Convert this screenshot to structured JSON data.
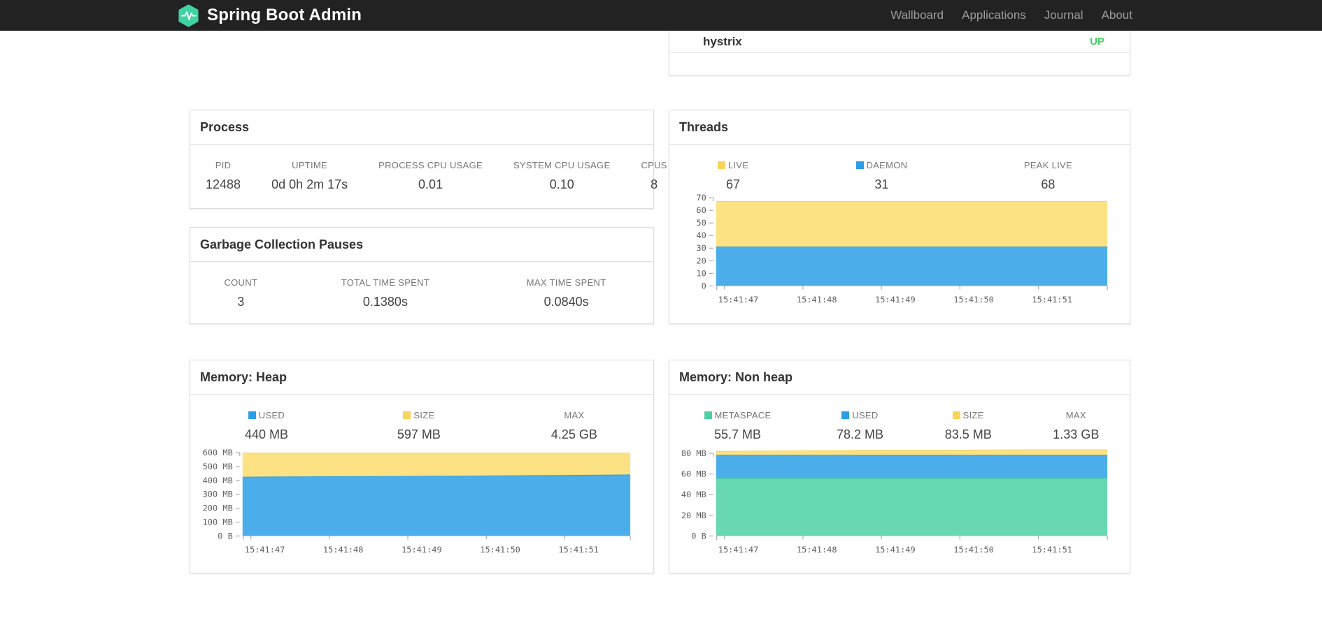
{
  "navbar": {
    "brand": "Spring Boot Admin",
    "items": [
      {
        "id": "wallboard",
        "label": "Wallboard"
      },
      {
        "id": "applications",
        "label": "Applications"
      },
      {
        "id": "journal",
        "label": "Journal"
      },
      {
        "id": "about",
        "label": "About"
      }
    ]
  },
  "colors": {
    "navbar_bg": "#222222",
    "brand_green": "#40d2a3",
    "status_up": "#44d35f",
    "area_yellow": "#fde283",
    "area_blue": "#4baeea",
    "area_green": "#67d8b1",
    "swatch_yellow": "#f8d45c",
    "swatch_blue": "#2b9ee5",
    "swatch_green": "#50cfa5"
  },
  "service_card": {
    "name": "hystrix",
    "status": "UP"
  },
  "cards": {
    "process": {
      "title": "Process",
      "stats": [
        {
          "label": "PID",
          "value": "12488"
        },
        {
          "label": "UPTIME",
          "value": "0d 0h 2m 17s"
        },
        {
          "label": "PROCESS CPU USAGE",
          "value": "0.01"
        },
        {
          "label": "SYSTEM CPU USAGE",
          "value": "0.10"
        },
        {
          "label": "CPUS",
          "value": "8"
        }
      ]
    },
    "gc": {
      "title": "Garbage Collection Pauses",
      "stats": [
        {
          "label": "COUNT",
          "value": "3"
        },
        {
          "label": "TOTAL TIME SPENT",
          "value": "0.1380s"
        },
        {
          "label": "MAX TIME SPENT",
          "value": "0.0840s"
        }
      ]
    },
    "threads": {
      "title": "Threads",
      "stats": [
        {
          "label": "LIVE",
          "value": "67",
          "swatch_color": "#f8d45c"
        },
        {
          "label": "DAEMON",
          "value": "31",
          "swatch_color": "#2b9ee5"
        },
        {
          "label": "PEAK LIVE",
          "value": "68"
        }
      ]
    },
    "heap": {
      "title": "Memory: Heap",
      "stats": [
        {
          "label": "USED",
          "value": "440 MB",
          "swatch_color": "#2b9ee5"
        },
        {
          "label": "SIZE",
          "value": "597 MB",
          "swatch_color": "#f8d45c"
        },
        {
          "label": "MAX",
          "value": "4.25 GB"
        }
      ]
    },
    "nonheap": {
      "title": "Memory: Non heap",
      "stats": [
        {
          "label": "METASPACE",
          "value": "55.7 MB",
          "swatch_color": "#50cfa5"
        },
        {
          "label": "USED",
          "value": "78.2 MB",
          "swatch_color": "#2b9ee5"
        },
        {
          "label": "SIZE",
          "value": "83.5 MB",
          "swatch_color": "#f8d45c"
        },
        {
          "label": "MAX",
          "value": "1.33 GB"
        }
      ]
    }
  },
  "chart_data": [
    {
      "id": "threads",
      "type": "area",
      "stacked": true,
      "title": "Threads",
      "x_labels": [
        "15:41:47",
        "15:41:48",
        "15:41:49",
        "15:41:50",
        "15:41:51"
      ],
      "ylim": [
        0,
        70
      ],
      "grid": false,
      "legend_position": "above",
      "y_ticks": [
        {
          "value": 0,
          "label": "0"
        },
        {
          "value": 10,
          "label": "10"
        },
        {
          "value": 20,
          "label": "20"
        },
        {
          "value": 30,
          "label": "30"
        },
        {
          "value": 40,
          "label": "40"
        },
        {
          "value": 50,
          "label": "50"
        },
        {
          "value": 60,
          "label": "60"
        },
        {
          "value": 70,
          "label": "70"
        }
      ],
      "series": [
        {
          "name": "LIVE",
          "color": "#fde283",
          "line_color": "#f3d363",
          "stack_top": [
            67,
            67,
            67,
            67,
            67,
            67
          ]
        },
        {
          "name": "DAEMON",
          "color": "#4baeea",
          "line_color": "#2f9fe2",
          "stack_top": [
            31,
            31,
            31,
            31,
            31,
            31
          ]
        }
      ]
    },
    {
      "id": "heap",
      "type": "area",
      "stacked": true,
      "title": "Memory: Heap",
      "x_labels": [
        "15:41:47",
        "15:41:48",
        "15:41:49",
        "15:41:50",
        "15:41:51"
      ],
      "ylim": [
        0,
        600
      ],
      "unit": "MB",
      "grid": false,
      "legend_position": "above",
      "y_ticks": [
        {
          "value": 0,
          "label": "0 B"
        },
        {
          "value": 100,
          "label": "100 MB"
        },
        {
          "value": 200,
          "label": "200 MB"
        },
        {
          "value": 300,
          "label": "300 MB"
        },
        {
          "value": 400,
          "label": "400 MB"
        },
        {
          "value": 500,
          "label": "500 MB"
        },
        {
          "value": 600,
          "label": "600 MB"
        }
      ],
      "series": [
        {
          "name": "SIZE",
          "color": "#fde283",
          "line_color": "#f3d363",
          "stack_top": [
            597,
            597,
            597,
            597,
            597,
            597
          ]
        },
        {
          "name": "USED",
          "color": "#4baeea",
          "line_color": "#2f9fe2",
          "stack_top": [
            424,
            427,
            429,
            432,
            436,
            440
          ]
        }
      ]
    },
    {
      "id": "nonheap",
      "type": "area",
      "stacked": true,
      "title": "Memory: Non heap",
      "x_labels": [
        "15:41:47",
        "15:41:48",
        "15:41:49",
        "15:41:50",
        "15:41:51"
      ],
      "ylim": [
        0,
        80
      ],
      "unit": "MB",
      "grid": false,
      "legend_position": "above",
      "y_ticks": [
        {
          "value": 0,
          "label": "0 B"
        },
        {
          "value": 20,
          "label": "20 MB"
        },
        {
          "value": 40,
          "label": "40 MB"
        },
        {
          "value": 60,
          "label": "60 MB"
        },
        {
          "value": 80,
          "label": "80 MB"
        }
      ],
      "series": [
        {
          "name": "SIZE",
          "color": "#fde283",
          "line_color": "#f3d363",
          "stack_top": [
            82,
            82.5,
            83,
            83,
            83.5,
            83.5
          ]
        },
        {
          "name": "USED",
          "color": "#4baeea",
          "line_color": "#2f9fe2",
          "stack_top": [
            78.2,
            78.2,
            78.2,
            78.2,
            78.2,
            78.2
          ]
        },
        {
          "name": "METASPACE",
          "color": "#67d8b1",
          "line_color": "#4fcba2",
          "stack_top": [
            55.7,
            55.7,
            55.7,
            55.7,
            55.7,
            55.7
          ]
        }
      ]
    }
  ]
}
